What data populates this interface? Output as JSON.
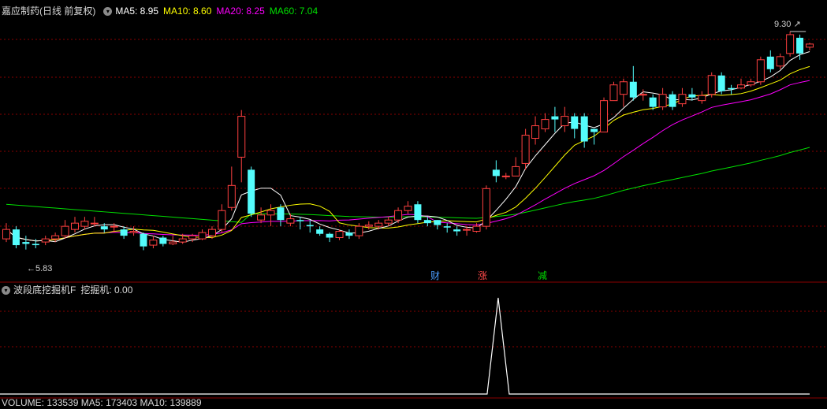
{
  "main_panel": {
    "title": "嘉应制药(日线 前复权)",
    "dropdown_icon": "chevron-down-icon",
    "indicators": [
      {
        "label": "MA5: 8.95",
        "color": "#ffffff"
      },
      {
        "label": "MA10: 8.60",
        "color": "#ffff00"
      },
      {
        "label": "MA20: 8.25",
        "color": "#ff00ff"
      },
      {
        "label": "MA60: 7.04",
        "color": "#00e000"
      }
    ],
    "high_label": "9.30",
    "low_label": "5.83",
    "events": [
      {
        "text": "财",
        "color": "#4a9cff"
      },
      {
        "text": "涨",
        "color": "#ff4a4a"
      },
      {
        "text": "减",
        "color": "#00dd00"
      }
    ]
  },
  "sub_panel": {
    "title": "波段底挖掘机F",
    "value_label": "挖掘机: 0.00"
  },
  "volume_panel": {
    "text": "VOLUME: 133539 MA5: 173403 MA10: 139889"
  },
  "colors": {
    "up": "#ff4040",
    "down": "#54fcfc",
    "grid": "#8a0000",
    "ma5": "#ffffff",
    "ma10": "#ffff00",
    "ma20": "#ff00ff",
    "ma60": "#00e000"
  },
  "chart_data": {
    "type": "candlestick",
    "value_range": [
      5.6,
      9.5
    ],
    "candles": [
      [
        6.0,
        6.15,
        6.25,
        5.95
      ],
      [
        6.15,
        5.9,
        6.2,
        5.85
      ],
      [
        5.95,
        5.92,
        6.05,
        5.83
      ],
      [
        5.92,
        5.9,
        6.0,
        5.85
      ],
      [
        5.95,
        6.0,
        6.05,
        5.9
      ],
      [
        6.0,
        6.05,
        6.1,
        5.95
      ],
      [
        6.05,
        6.2,
        6.3,
        6.0
      ],
      [
        6.15,
        6.25,
        6.35,
        6.1
      ],
      [
        6.2,
        6.28,
        6.35,
        6.15
      ],
      [
        6.25,
        6.25,
        6.35,
        6.2
      ],
      [
        6.2,
        6.15,
        6.25,
        6.1
      ],
      [
        6.2,
        6.2,
        6.25,
        6.1
      ],
      [
        6.15,
        6.05,
        6.2,
        6.0
      ],
      [
        6.1,
        6.12,
        6.2,
        6.05
      ],
      [
        6.08,
        5.88,
        6.1,
        5.82
      ],
      [
        5.9,
        5.98,
        6.05,
        5.85
      ],
      [
        6.02,
        5.92,
        6.05,
        5.88
      ],
      [
        5.92,
        5.95,
        6.05,
        5.9
      ],
      [
        5.95,
        6.0,
        6.08,
        5.92
      ],
      [
        6.0,
        6.05,
        6.08,
        5.95
      ],
      [
        6.0,
        6.1,
        6.15,
        5.98
      ],
      [
        6.05,
        6.15,
        6.2,
        6.0
      ],
      [
        6.15,
        6.45,
        6.55,
        6.1
      ],
      [
        6.5,
        6.85,
        7.15,
        6.45
      ],
      [
        7.3,
        7.95,
        8.05,
        6.9
      ],
      [
        7.1,
        6.4,
        7.15,
        6.35
      ],
      [
        6.3,
        6.38,
        6.5,
        6.25
      ],
      [
        6.38,
        6.45,
        6.55,
        6.2
      ],
      [
        6.5,
        6.3,
        6.55,
        6.2
      ],
      [
        6.25,
        6.32,
        6.4,
        6.2
      ],
      [
        6.3,
        6.28,
        6.35,
        6.15
      ],
      [
        6.22,
        6.2,
        6.3,
        6.1
      ],
      [
        6.15,
        6.08,
        6.2,
        6.05
      ],
      [
        6.08,
        6.02,
        6.1,
        5.95
      ],
      [
        6.02,
        6.12,
        6.15,
        5.98
      ],
      [
        6.1,
        6.05,
        6.15,
        6.0
      ],
      [
        6.05,
        6.2,
        6.25,
        6.0
      ],
      [
        6.2,
        6.22,
        6.28,
        6.15
      ],
      [
        6.2,
        6.25,
        6.3,
        6.15
      ],
      [
        6.25,
        6.3,
        6.35,
        6.2
      ],
      [
        6.3,
        6.45,
        6.5,
        6.25
      ],
      [
        6.45,
        6.52,
        6.6,
        6.4
      ],
      [
        6.55,
        6.3,
        6.6,
        6.25
      ],
      [
        6.3,
        6.25,
        6.35,
        6.2
      ],
      [
        6.3,
        6.22,
        6.3,
        6.15
      ],
      [
        6.2,
        6.18,
        6.25,
        6.1
      ],
      [
        6.15,
        6.12,
        6.2,
        6.05
      ],
      [
        6.15,
        6.15,
        6.2,
        6.05
      ],
      [
        6.12,
        6.2,
        6.25,
        6.1
      ],
      [
        6.2,
        6.8,
        6.85,
        6.15
      ],
      [
        7.1,
        7.0,
        7.25,
        6.9
      ],
      [
        7.0,
        7.0,
        7.05,
        6.95
      ],
      [
        7.0,
        7.15,
        7.3,
        7.0
      ],
      [
        7.2,
        7.65,
        7.75,
        7.1
      ],
      [
        7.6,
        7.8,
        7.95,
        7.5
      ],
      [
        7.75,
        7.9,
        8.0,
        7.7
      ],
      [
        7.95,
        7.9,
        8.1,
        7.7
      ],
      [
        7.8,
        7.95,
        8.1,
        7.7
      ],
      [
        7.95,
        7.75,
        8.0,
        7.6
      ],
      [
        7.95,
        7.55,
        8.0,
        7.45
      ],
      [
        7.75,
        7.7,
        7.75,
        7.5
      ],
      [
        7.7,
        8.2,
        8.25,
        7.7
      ],
      [
        8.2,
        8.45,
        8.5,
        8.2
      ],
      [
        8.3,
        8.5,
        8.55,
        8.1
      ],
      [
        8.5,
        8.25,
        8.75,
        8.2
      ],
      [
        8.3,
        8.3,
        8.38,
        8.2
      ],
      [
        8.25,
        8.1,
        8.3,
        8.05
      ],
      [
        8.1,
        8.3,
        8.4,
        8.05
      ],
      [
        8.3,
        8.1,
        8.35,
        8.05
      ],
      [
        8.15,
        8.3,
        8.4,
        8.1
      ],
      [
        8.3,
        8.25,
        8.4,
        8.2
      ],
      [
        8.2,
        8.28,
        8.35,
        8.15
      ],
      [
        8.3,
        8.6,
        8.65,
        8.25
      ],
      [
        8.6,
        8.35,
        8.65,
        8.3
      ],
      [
        8.4,
        8.38,
        8.45,
        8.3
      ],
      [
        8.4,
        8.45,
        8.55,
        8.38
      ],
      [
        8.45,
        8.5,
        8.55,
        8.42
      ],
      [
        8.5,
        8.85,
        8.9,
        8.45
      ],
      [
        8.9,
        8.7,
        9.0,
        8.65
      ],
      [
        8.75,
        8.9,
        8.95,
        8.7
      ],
      [
        8.95,
        9.25,
        9.3,
        8.9
      ],
      [
        9.2,
        8.95,
        9.25,
        8.85
      ],
      [
        9.05,
        9.1,
        9.12,
        9.0
      ]
    ],
    "ma5_level": 8.95,
    "ma10_level": 8.6,
    "ma20_level": 8.25,
    "ma60_level": 7.04,
    "sub_signal": {
      "type": "line",
      "peak_value": 1,
      "baseline_value": 0
    }
  }
}
